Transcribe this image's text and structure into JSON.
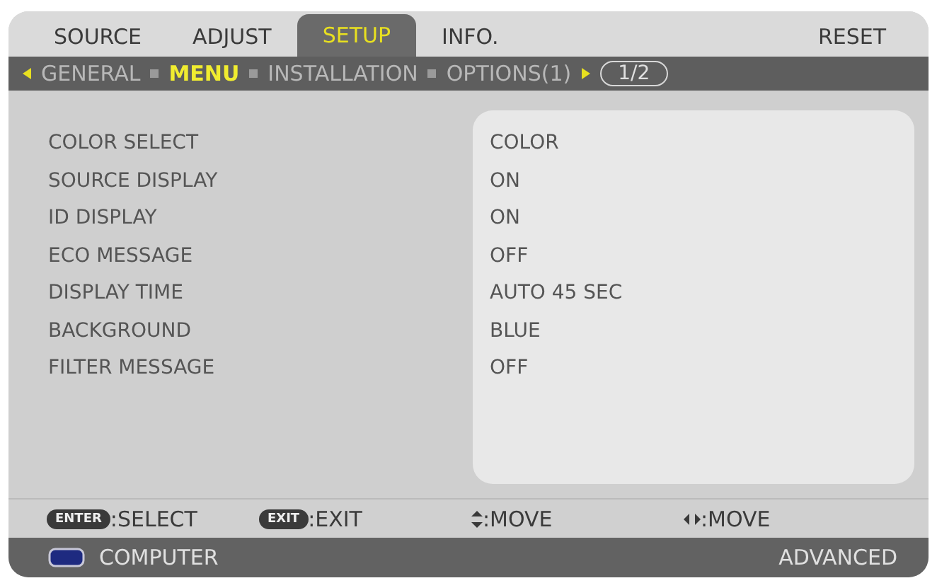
{
  "tabs": [
    {
      "label": "SOURCE",
      "selected": false
    },
    {
      "label": "ADJUST",
      "selected": false
    },
    {
      "label": "SETUP",
      "selected": true
    },
    {
      "label": "INFO.",
      "selected": false
    },
    {
      "label": "RESET",
      "selected": false
    }
  ],
  "subtabs": [
    {
      "label": "GENERAL",
      "selected": false
    },
    {
      "label": "MENU",
      "selected": true
    },
    {
      "label": "INSTALLATION",
      "selected": false
    },
    {
      "label": "OPTIONS(1)",
      "selected": false
    }
  ],
  "page": "1/2",
  "settings": [
    {
      "label": "COLOR SELECT",
      "value": "COLOR"
    },
    {
      "label": "SOURCE DISPLAY",
      "value": "ON"
    },
    {
      "label": "ID DISPLAY",
      "value": "ON"
    },
    {
      "label": "ECO MESSAGE",
      "value": "OFF"
    },
    {
      "label": "DISPLAY TIME",
      "value": "AUTO 45 SEC"
    },
    {
      "label": "BACKGROUND",
      "value": "BLUE"
    },
    {
      "label": "FILTER MESSAGE",
      "value": "OFF"
    }
  ],
  "hints": [
    {
      "kind": "key",
      "key": "ENTER",
      "action": ":SELECT"
    },
    {
      "kind": "key",
      "key": "EXIT",
      "action": ":EXIT"
    },
    {
      "kind": "updown",
      "action": ":MOVE"
    },
    {
      "kind": "leftright",
      "action": ":MOVE"
    }
  ],
  "status": {
    "source": "COMPUTER",
    "mode": "ADVANCED"
  }
}
